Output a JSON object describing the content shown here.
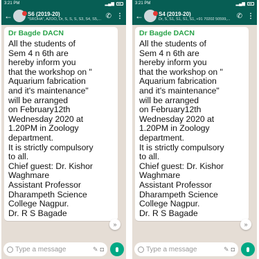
{
  "screens": [
    {
      "status_time": "3:21 PM",
      "group_name": "S6 (2019-20)",
      "participants": "\"SROHA\", AZOO, Dr, S, S, S, S3, S4, S5,...",
      "sender": "Dr Bagde DACN",
      "message_lines": [
        "All the students of",
        "Sem 4 n 6th are",
        "hereby inform you",
        "that the workshop on \"",
        "Aquarium fabrication",
        "and it's maintenance\"",
        "will be arranged",
        "on February12th",
        "Wednesday 2020 at",
        "1.20PM in Zoology",
        "department.",
        "It is strictly compulsory",
        "to all.",
        "Chief guest: Dr. Kishor",
        "Waghmare",
        "Assistant Professor",
        "Dharampeth Science",
        "College Nagpur.",
        "Dr. R S Bagade"
      ],
      "input_placeholder": "Type a message"
    },
    {
      "status_time": "3:21 PM",
      "group_name": "S4 (2019-20)",
      "participants": "Dr, S, S1, S1, S1, S1, +91 70202 50599,...",
      "sender": "Dr Bagde DACN",
      "message_lines": [
        "All the students of",
        "Sem 4 n 6th are",
        "hereby inform you",
        "that the workshop on \"",
        "Aquarium fabrication",
        "and it's maintenance\"",
        "will be arranged",
        "on February12th",
        "Wednesday 2020 at",
        "1.20PM in Zoology",
        "department.",
        "It is strictly compulsory",
        "to all.",
        "Chief guest: Dr. Kishor",
        "Waghmare",
        "Assistant Professor",
        "Dharampeth Science",
        "College Nagpur.",
        "Dr. R S Bagade"
      ],
      "input_placeholder": "Type a message"
    }
  ],
  "icons": {
    "back": "back-arrow-icon",
    "call": "call-add-icon",
    "menu": "more-vert-icon",
    "emoji": "emoji-icon",
    "attach": "attach-icon",
    "camera": "camera-icon",
    "mic": "mic-icon",
    "scroll": "scroll-down-icon"
  },
  "colors": {
    "header": "#075e54",
    "chat_background": "#e5ddd5",
    "sender_name": "#2aa34a",
    "mic_button": "#00a884"
  }
}
